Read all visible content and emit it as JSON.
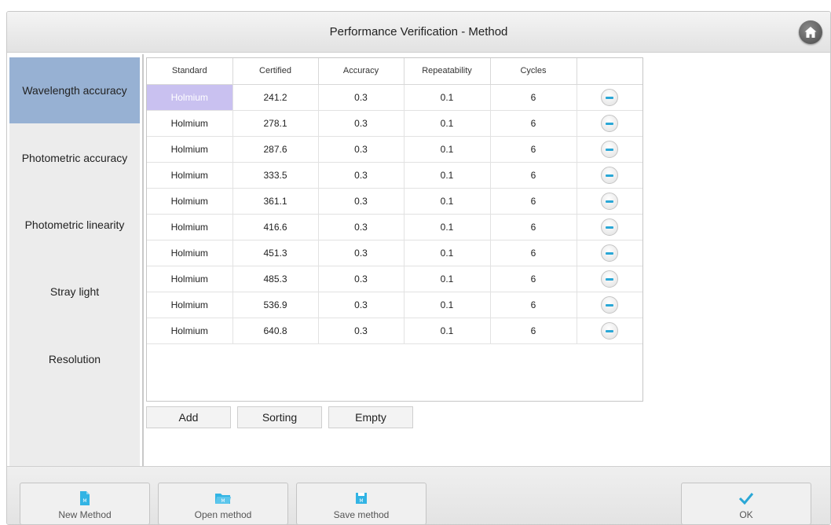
{
  "window": {
    "title": "Performance Verification - Method"
  },
  "sidebar": {
    "items": [
      {
        "label": "Wavelength accuracy",
        "active": true
      },
      {
        "label": "Photometric accuracy",
        "active": false
      },
      {
        "label": "Photometric linearity",
        "active": false
      },
      {
        "label": "Stray light",
        "active": false
      },
      {
        "label": "Resolution",
        "active": false
      }
    ]
  },
  "table": {
    "columns": [
      "Standard",
      "Certified",
      "Accuracy",
      "Repeatability",
      "Cycles"
    ],
    "rows": [
      [
        "Holmium",
        "241.2",
        "0.3",
        "0.1",
        "6"
      ],
      [
        "Holmium",
        "278.1",
        "0.3",
        "0.1",
        "6"
      ],
      [
        "Holmium",
        "287.6",
        "0.3",
        "0.1",
        "6"
      ],
      [
        "Holmium",
        "333.5",
        "0.3",
        "0.1",
        "6"
      ],
      [
        "Holmium",
        "361.1",
        "0.3",
        "0.1",
        "6"
      ],
      [
        "Holmium",
        "416.6",
        "0.3",
        "0.1",
        "6"
      ],
      [
        "Holmium",
        "451.3",
        "0.3",
        "0.1",
        "6"
      ],
      [
        "Holmium",
        "485.3",
        "0.3",
        "0.1",
        "6"
      ],
      [
        "Holmium",
        "536.9",
        "0.3",
        "0.1",
        "6"
      ],
      [
        "Holmium",
        "640.8",
        "0.3",
        "0.1",
        "6"
      ]
    ],
    "selected_cell": [
      0,
      0
    ],
    "row_action_icon": "minus-circle-icon"
  },
  "actions": {
    "add": "Add",
    "sorting": "Sorting",
    "empty": "Empty"
  },
  "bottom": {
    "new_method": "New Method",
    "open_method": "Open method",
    "save_method": "Save method",
    "ok": "OK"
  },
  "colors": {
    "sidebar_active": "#97b1d3",
    "selected_cell": "#c9c1f0",
    "icon_accent": "#2aa7d6"
  }
}
